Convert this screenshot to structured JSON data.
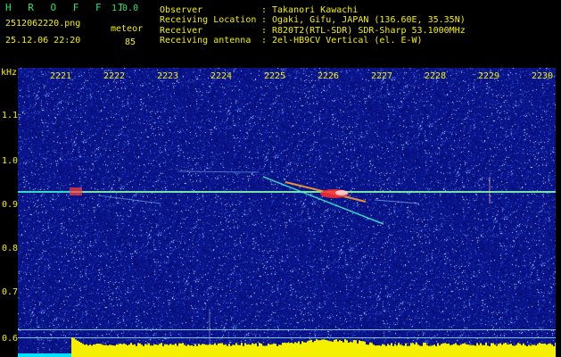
{
  "header": {
    "app_title": "H R O F F T",
    "app_version": "1.0.0",
    "file_name": "2512062220.png",
    "date_time": "25.12.06 22:20",
    "meteor_label": "meteor",
    "meteor_count": "85",
    "info": [
      {
        "label": "Observer",
        "value": "Takanori Kawachi"
      },
      {
        "label": "Receiving Location",
        "value": "Ogaki, Gifu, JAPAN (136.60E, 35.35N)"
      },
      {
        "label": "Receiver",
        "value": "R820T2(RTL-SDR) SDR-Sharp 53.1000MHz"
      },
      {
        "label": "Receiving antenna",
        "value": "2el-HB9CV Vertical (el. E-W)"
      }
    ],
    "separator": ":"
  },
  "axes": {
    "unit": "kHz",
    "time_ticks": [
      "2221",
      "2222",
      "2223",
      "2224",
      "2225",
      "2226",
      "2227",
      "2228",
      "2229",
      "2230"
    ],
    "freq_ticks": [
      "1.1",
      "1.0",
      "0.9",
      "0.8",
      "0.7",
      "0.6"
    ]
  },
  "colors": {
    "background": "#000000",
    "plot": "#09138a",
    "text": "#f5f000",
    "carrier": "#40ffd0",
    "echo": "#ff3030",
    "bottom_bar": "#f5f000",
    "bottom_bar_low": "#00e0ff"
  }
}
